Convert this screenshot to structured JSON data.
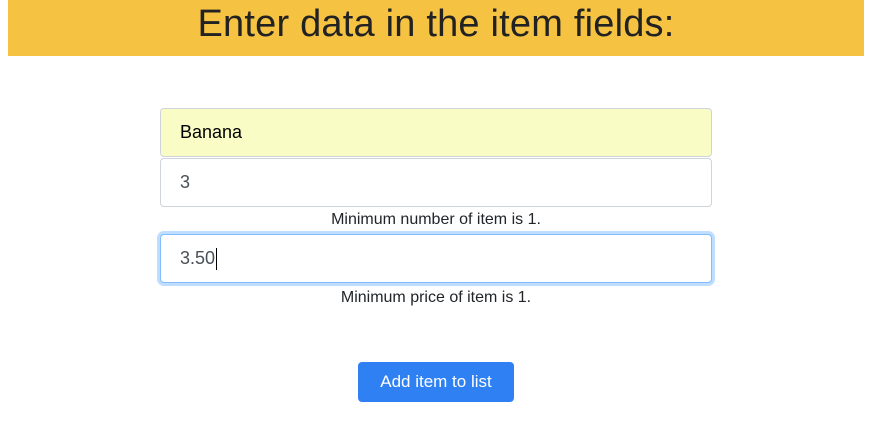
{
  "header": {
    "title": "Enter data in the item fields:",
    "background_color": "#f5c242"
  },
  "form": {
    "name_field": {
      "value": "Banana",
      "state": "autofilled"
    },
    "quantity_field": {
      "value": "3"
    },
    "quantity_hint": "Minimum number of item is 1.",
    "price_field": {
      "value": "3.50",
      "state": "focused"
    },
    "price_hint": "Minimum price of item is 1."
  },
  "actions": {
    "add_button_label": "Add item to list",
    "add_button_color": "#2f80f3"
  }
}
